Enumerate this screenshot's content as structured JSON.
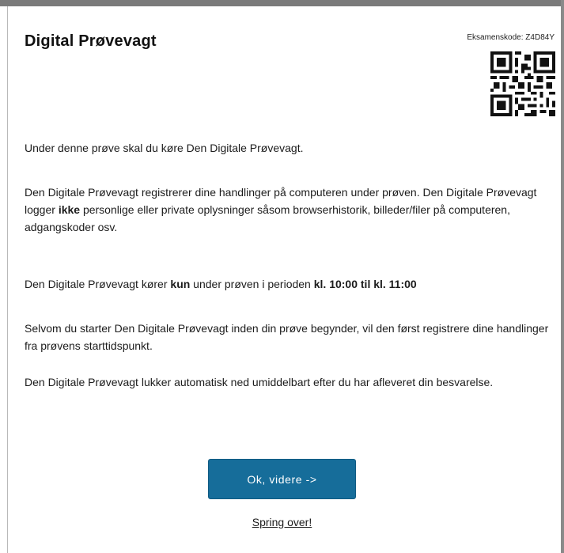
{
  "header": {
    "title": "Digital Prøvevagt",
    "exam_code": "Eksamenskode: Z4D84Y",
    "qr": "qr-code-icon"
  },
  "content": {
    "p1": "Under denne prøve skal du køre Den Digitale Prøvevagt.",
    "p2_pre": "Den Digitale Prøvevagt registrerer dine handlinger på computeren under prøven. Den Digitale Prøvevagt logger ",
    "p2_bold": "ikke",
    "p2_post": " personlige eller private oplysninger såsom browserhistorik, billeder/filer på computeren, adgangskoder osv.",
    "p3_pre": "Den Digitale Prøvevagt kører ",
    "p3_bold1": "kun",
    "p3_mid": " under prøven i perioden ",
    "p3_bold2": "kl. 10:00 til kl. 11:00",
    "p4": "Selvom du starter Den Digitale Prøvevagt inden din prøve begynder, vil den først registrere dine handlinger fra prøvens starttidspunkt.",
    "p5": "Den Digitale Prøvevagt lukker automatisk ned umiddelbart efter du har afleveret din besvarelse."
  },
  "actions": {
    "ok_label": "Ok, videre ->",
    "skip_label": "Spring over!"
  },
  "colors": {
    "button": "#166d9a",
    "frame": "#7a7a7a"
  }
}
